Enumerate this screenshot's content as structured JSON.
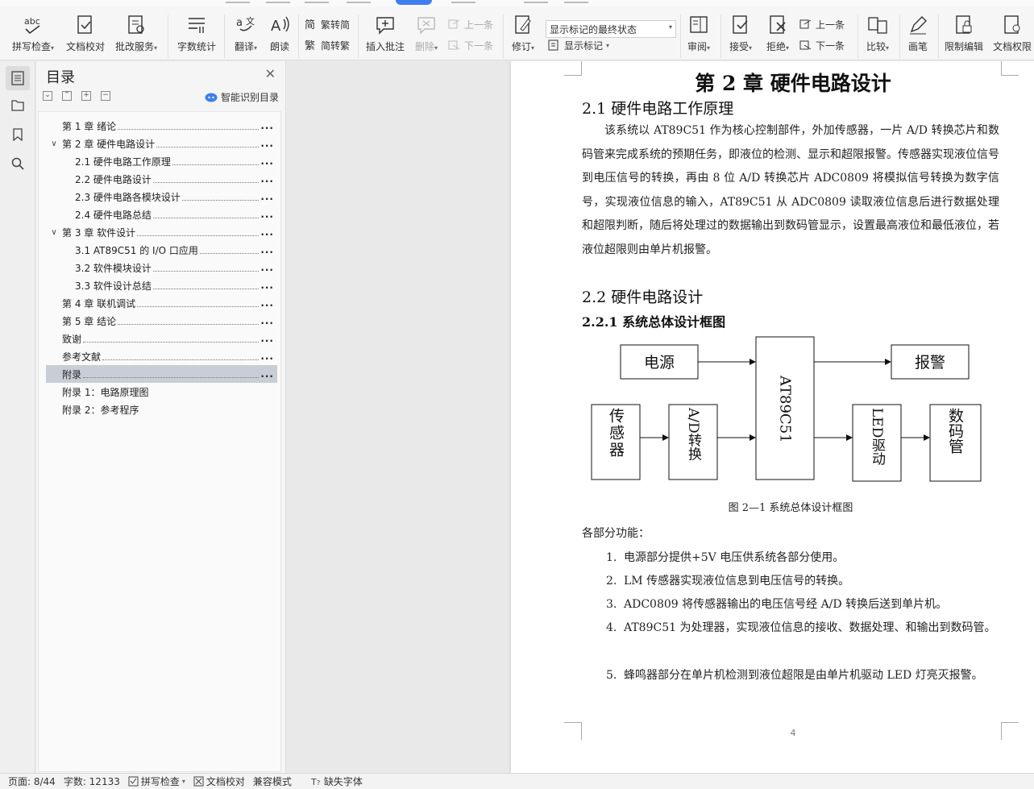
{
  "ribbon": {
    "spell_check": "拼写检查",
    "doc_proof": "文档校对",
    "review_service": "批改服务",
    "word_count": "字数统计",
    "translate": "翻译",
    "read_aloud": "朗读",
    "trad_to_simp": "繁转简",
    "simp_to_trad": "简转繁",
    "insert_comment": "插入批注",
    "delete": "删除",
    "prev": "上一条",
    "next": "下一条",
    "track_changes": "修订",
    "markup_state": "显示标记的最终状态",
    "show_markup": "显示标记",
    "review": "审阅",
    "accept": "接受",
    "reject": "拒绝",
    "prev2": "上一条",
    "next2": "下一条",
    "compare": "比较",
    "pen": "画笔",
    "restrict_edit": "限制编辑",
    "doc_permission": "文档权限"
  },
  "toc": {
    "title": "目录",
    "smart_label": "智能识别目录",
    "items": [
      {
        "text": "第 1 章  绪论",
        "page": "...",
        "level": 1,
        "toggle": ""
      },
      {
        "text": "第 2 章  硬件电路设计",
        "page": "...",
        "level": 1,
        "toggle": "∨"
      },
      {
        "text": "2.1  硬件电路工作原理",
        "page": "...",
        "level": 2,
        "toggle": ""
      },
      {
        "text": "2.2  硬件电路设计",
        "page": "...",
        "level": 2,
        "toggle": ""
      },
      {
        "text": "2.3  硬件电路各模块设计",
        "page": "...",
        "level": 2,
        "toggle": ""
      },
      {
        "text": "2.4  硬件电路总结",
        "page": "...",
        "level": 2,
        "toggle": ""
      },
      {
        "text": "第 3 章  软件设计",
        "page": "...",
        "level": 1,
        "toggle": "∨"
      },
      {
        "text": "3.1  AT89C51 的 I/O 口应用",
        "page": "...",
        "level": 2,
        "toggle": ""
      },
      {
        "text": "3.2  软件模块设计",
        "page": "...",
        "level": 2,
        "toggle": ""
      },
      {
        "text": "3.3  软件设计总结",
        "page": "...",
        "level": 2,
        "toggle": ""
      },
      {
        "text": "第 4 章  联机调试",
        "page": "...",
        "level": 1,
        "toggle": ""
      },
      {
        "text": "第 5 章  结论",
        "page": "...",
        "level": 1,
        "toggle": ""
      },
      {
        "text": "致谢",
        "page": "...",
        "level": 1,
        "toggle": ""
      },
      {
        "text": "参考文献",
        "page": "...",
        "level": 1,
        "toggle": ""
      },
      {
        "text": "附录",
        "page": "...",
        "level": 1,
        "toggle": "",
        "selected": true
      },
      {
        "text": "附录 1：电路原理图",
        "page": "",
        "level": 1,
        "toggle": ""
      },
      {
        "text": "附录 2：参考程序",
        "page": "",
        "level": 1,
        "toggle": ""
      }
    ]
  },
  "doc": {
    "chapter_title": "第 2 章    硬件电路设计",
    "sec_2_1": "2.1    硬件电路工作原理",
    "para_2_1": "该系统以 AT89C51 作为核心控制部件，外加传感器，一片 A/D 转换芯片和数码管来完成系统的预期任务，即液位的检测、显示和超限报警。传感器实现液位信号到电压信号的转换，再由 8 位 A/D 转换芯片 ADC0809 将模拟信号转换为数字信号，实现液位信息的输入，AT89C51 从 ADC0809 读取液位信息后进行数据处理和超限判断，随后将处理过的数据输出到数码管显示，设置最高液位和最低液位，若液位超限则由单片机报警。",
    "sec_2_2": "2.2    硬件电路设计",
    "sec_2_2_1": "2.2.1    系统总体设计框图",
    "diagram": {
      "power": "电源",
      "alarm": "报警",
      "sensor": "传感器",
      "adc": "A/D转换",
      "mcu": "AT89C51",
      "led": "LED驱动",
      "display": "数码管"
    },
    "caption": "图 2—1  系统总体设计框图",
    "lead": "各部分功能：",
    "list": [
      {
        "num": "1.",
        "text": "电源部分提供+5V 电压供系统各部分使用。"
      },
      {
        "num": "2.",
        "text": "LM 传感器实现液位信息到电压信号的转换。"
      },
      {
        "num": "3.",
        "text": "ADC0809 将传感器输出的电压信号经 A/D 转换后送到单片机。"
      },
      {
        "num": "4.",
        "text": "AT89C51 为处理器，实现液位信息的接收、数据处理、和输出到数码管。"
      },
      {
        "num": "5.",
        "text": "蜂鸣器部分在单片机检测到液位超限是由单片机驱动 LED 灯亮灭报警。"
      }
    ],
    "page_number": "4"
  },
  "status": {
    "page": "页面: 8/44",
    "words": "字数: 12133",
    "spell": "拼写检查",
    "proof": "文档校对",
    "compat": "兼容模式",
    "missing_font": "缺失字体"
  },
  "colors": {
    "accent": "#3d7ef0",
    "toc_selected": "#c9ced6"
  }
}
